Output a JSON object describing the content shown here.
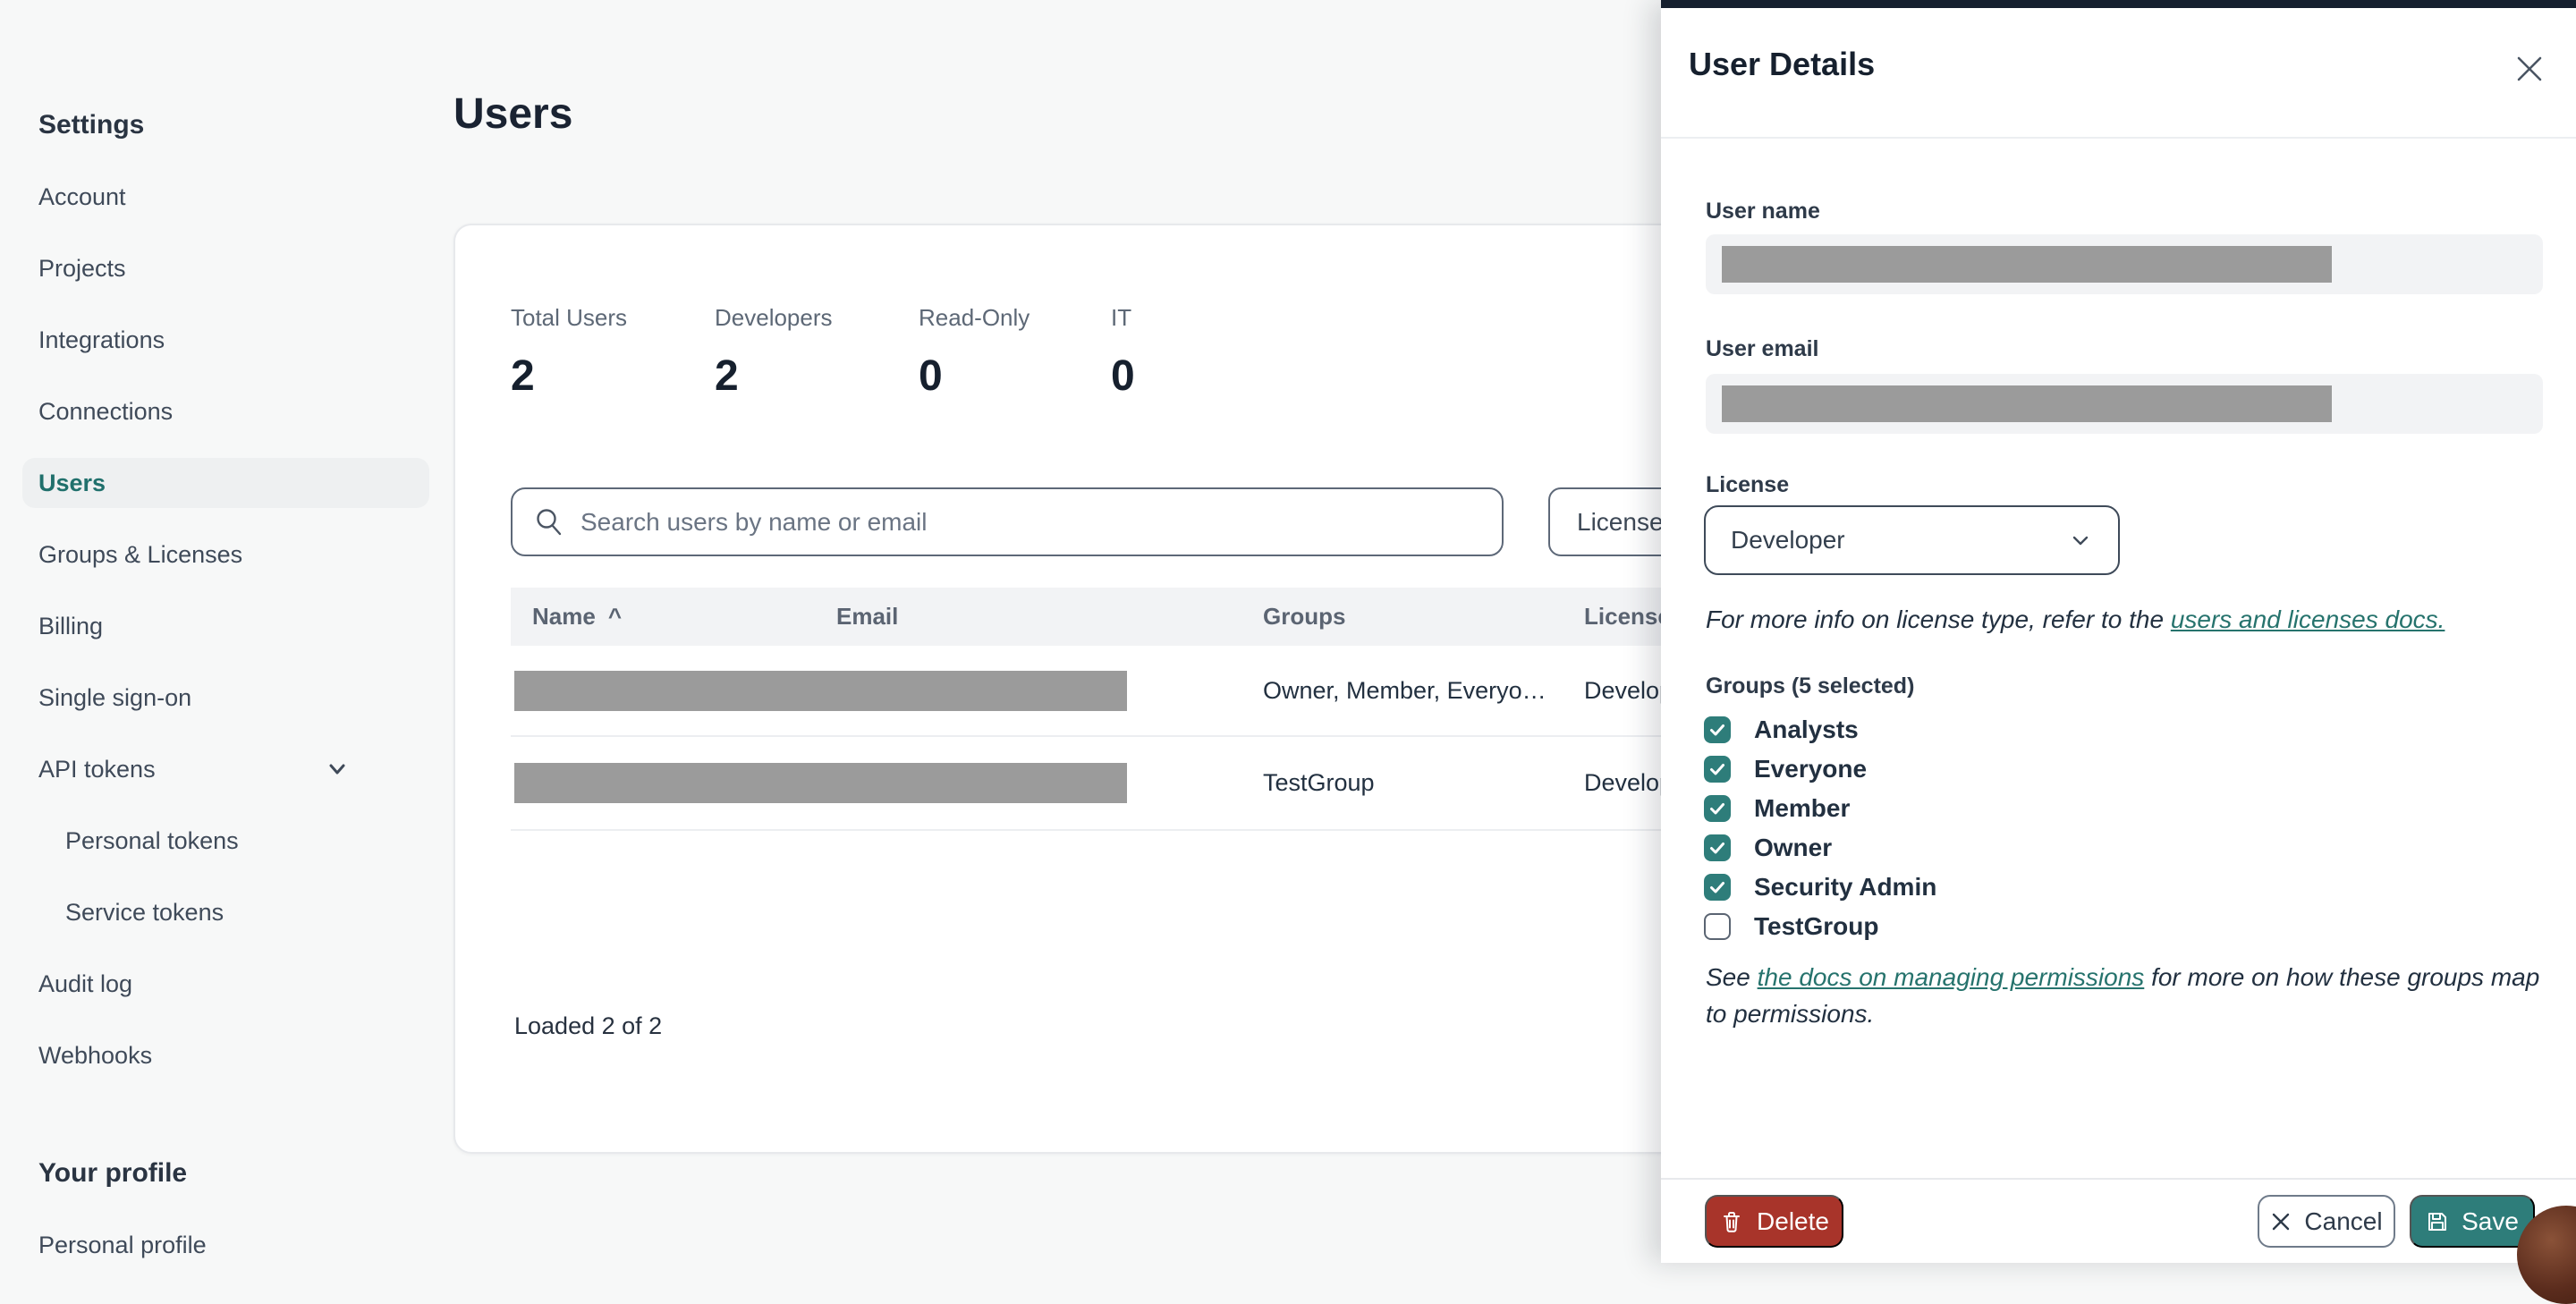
{
  "colors": {
    "accent_teal": "#2E7D7A",
    "active_nav_teal": "#20706C",
    "link_teal": "#26736D",
    "delete_red": "#A8342A",
    "redaction_gray": "#9B9B9B",
    "drawer_topbar_dark": "#16202F",
    "page_background": "#F7F8F8"
  },
  "sidebar": {
    "section_title": "Settings",
    "items": [
      {
        "label": "Account"
      },
      {
        "label": "Projects"
      },
      {
        "label": "Integrations"
      },
      {
        "label": "Connections"
      },
      {
        "label": "Users",
        "active": true
      },
      {
        "label": "Groups & Licenses"
      },
      {
        "label": "Billing"
      },
      {
        "label": "Single sign-on"
      },
      {
        "label": "API tokens",
        "chevron": "chevron-down"
      },
      {
        "label": "Personal tokens",
        "indent": true
      },
      {
        "label": "Service tokens",
        "indent": true
      },
      {
        "label": "Audit log"
      },
      {
        "label": "Webhooks"
      }
    ],
    "profile_section_title": "Your profile",
    "profile_items": [
      {
        "label": "Personal profile"
      }
    ]
  },
  "main": {
    "page_title": "Users",
    "stats": [
      {
        "label": "Total Users",
        "value": "2"
      },
      {
        "label": "Developers",
        "value": "2"
      },
      {
        "label": "Read-Only",
        "value": "0"
      },
      {
        "label": "IT",
        "value": "0"
      }
    ],
    "search": {
      "placeholder": "Search users by name or email",
      "value": ""
    },
    "license_filter_label": "License",
    "table": {
      "headers": {
        "name": "Name",
        "email": "Email",
        "groups": "Groups",
        "license": "License"
      },
      "sort_caret": "^",
      "rows": [
        {
          "name_redacted": true,
          "email_redacted": true,
          "groups": "Owner, Member, Everyo…",
          "license": "Developer"
        },
        {
          "name_redacted": true,
          "email_redacted": true,
          "groups": "TestGroup",
          "license": "Developer"
        }
      ],
      "status": "Loaded 2 of 2"
    }
  },
  "drawer": {
    "title": "User Details",
    "fields": {
      "user_name_label": "User name",
      "user_name_redacted": true,
      "user_email_label": "User email",
      "user_email_redacted": true,
      "license_label": "License",
      "license_value": "Developer"
    },
    "license_note": {
      "prefix": "For more info on license type, refer to the ",
      "link": "users and licenses docs."
    },
    "groups": {
      "label": "Groups (5 selected)",
      "options": [
        {
          "label": "Analysts",
          "checked": true
        },
        {
          "label": "Everyone",
          "checked": true
        },
        {
          "label": "Member",
          "checked": true
        },
        {
          "label": "Owner",
          "checked": true
        },
        {
          "label": "Security Admin",
          "checked": true
        },
        {
          "label": "TestGroup",
          "checked": false
        }
      ]
    },
    "permissions_note": {
      "prefix": "See ",
      "link": "the docs on managing permissions",
      "suffix": " for more on how these groups map to permissions."
    },
    "footer": {
      "delete_label": "Delete",
      "cancel_label": "Cancel",
      "save_label": "Save"
    }
  }
}
